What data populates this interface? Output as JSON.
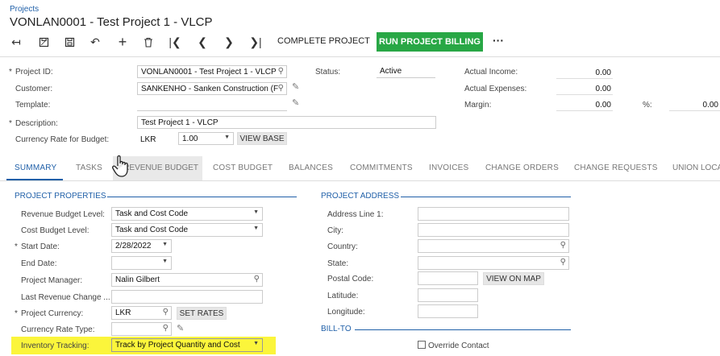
{
  "breadcrumb": "Projects",
  "page_title": "VONLAN0001 - Test Project 1 - VLCP",
  "toolbar": {
    "complete_project": "COMPLETE PROJECT",
    "run_project_billing": "RUN PROJECT BILLING",
    "more": "···"
  },
  "header": {
    "project_id_label": "Project ID:",
    "project_id_value": "VONLAN0001 - Test Project 1 - VLCP",
    "customer_label": "Customer:",
    "customer_value": "SANKENHO - Sanken Construction (F",
    "template_label": "Template:",
    "template_value": "",
    "description_label": "Description:",
    "description_value": "Test Project 1 - VLCP",
    "currency_rate_label": "Currency Rate for Budget:",
    "currency_code": "LKR",
    "currency_rate": "1.00",
    "view_base": "VIEW BASE",
    "status_label": "Status:",
    "status_value": "Active",
    "actual_income_label": "Actual Income:",
    "actual_income_value": "0.00",
    "actual_expenses_label": "Actual Expenses:",
    "actual_expenses_value": "0.00",
    "margin_label": "Margin:",
    "margin_value": "0.00",
    "pct_label": "%:",
    "pct_value": "0.00"
  },
  "tabs": [
    {
      "label": "SUMMARY"
    },
    {
      "label": "TASKS"
    },
    {
      "label": "REVENUE BUDGET"
    },
    {
      "label": "COST BUDGET"
    },
    {
      "label": "BALANCES"
    },
    {
      "label": "COMMITMENTS"
    },
    {
      "label": "INVOICES"
    },
    {
      "label": "CHANGE ORDERS"
    },
    {
      "label": "CHANGE REQUESTS"
    },
    {
      "label": "UNION LOCA"
    }
  ],
  "project_properties": {
    "header": "PROJECT PROPERTIES",
    "revenue_budget_level_label": "Revenue Budget Level:",
    "revenue_budget_level_value": "Task and Cost Code",
    "cost_budget_level_label": "Cost Budget Level:",
    "cost_budget_level_value": "Task and Cost Code",
    "start_date_label": "Start Date:",
    "start_date_value": "2/28/2022",
    "end_date_label": "End Date:",
    "end_date_value": "",
    "project_manager_label": "Project Manager:",
    "project_manager_value": "Nalin Gilbert",
    "last_revenue_change_label": "Last Revenue Change ...",
    "last_revenue_change_value": "",
    "project_currency_label": "Project Currency:",
    "project_currency_value": "LKR",
    "set_rates": "SET RATES",
    "currency_rate_type_label": "Currency Rate Type:",
    "currency_rate_type_value": "",
    "inventory_tracking_label": "Inventory Tracking:",
    "inventory_tracking_value": "Track by Project Quantity and Cost"
  },
  "project_address": {
    "header": "PROJECT ADDRESS",
    "address_line1_label": "Address Line 1:",
    "city_label": "City:",
    "country_label": "Country:",
    "state_label": "State:",
    "postal_code_label": "Postal Code:",
    "view_on_map": "VIEW ON MAP",
    "latitude_label": "Latitude:",
    "longitude_label": "Longitude:"
  },
  "bill_to": {
    "header": "BILL-TO",
    "override_contact": "Override Contact"
  },
  "colors": {
    "accent": "#1f5fa8",
    "primary_button": "#28a745",
    "highlight": "#fbf53b"
  }
}
